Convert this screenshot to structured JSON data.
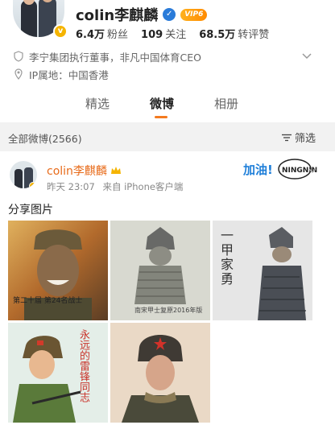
{
  "profile": {
    "name": "colin李麒麟",
    "vip_label": "VIP6",
    "stats": [
      {
        "value": "6.4万",
        "label": "粉丝"
      },
      {
        "value": "109",
        "label": "关注"
      },
      {
        "value": "68.5万",
        "label": "转评赞"
      }
    ],
    "bio": "李宁集团执行董事，非凡中国体育CEO",
    "ip_location": "IP属地：中国香港"
  },
  "tabs": [
    {
      "label": "精选",
      "active": false
    },
    {
      "label": "微博",
      "active": true
    },
    {
      "label": "相册",
      "active": false
    }
  ],
  "feed": {
    "count_label": "全部微博(2566)",
    "filter_label": "筛选"
  },
  "post": {
    "author": "colin李麒麟",
    "time": "昨天 23:07",
    "source": "来自 iPhone客户端",
    "title": "分享图片",
    "images": [
      {
        "caption": "第二十届 第24名战士"
      },
      {
        "caption": "南宋甲士复原2016年版"
      },
      {
        "caption": "一甲家勇"
      },
      {
        "caption": "永远的雷锋同志"
      },
      {
        "caption": ""
      }
    ]
  },
  "colors": {
    "accent": "#f47a1f",
    "verify": "#2a7bd9",
    "gold": "#f5b400",
    "link_orange": "#e86b1a"
  }
}
